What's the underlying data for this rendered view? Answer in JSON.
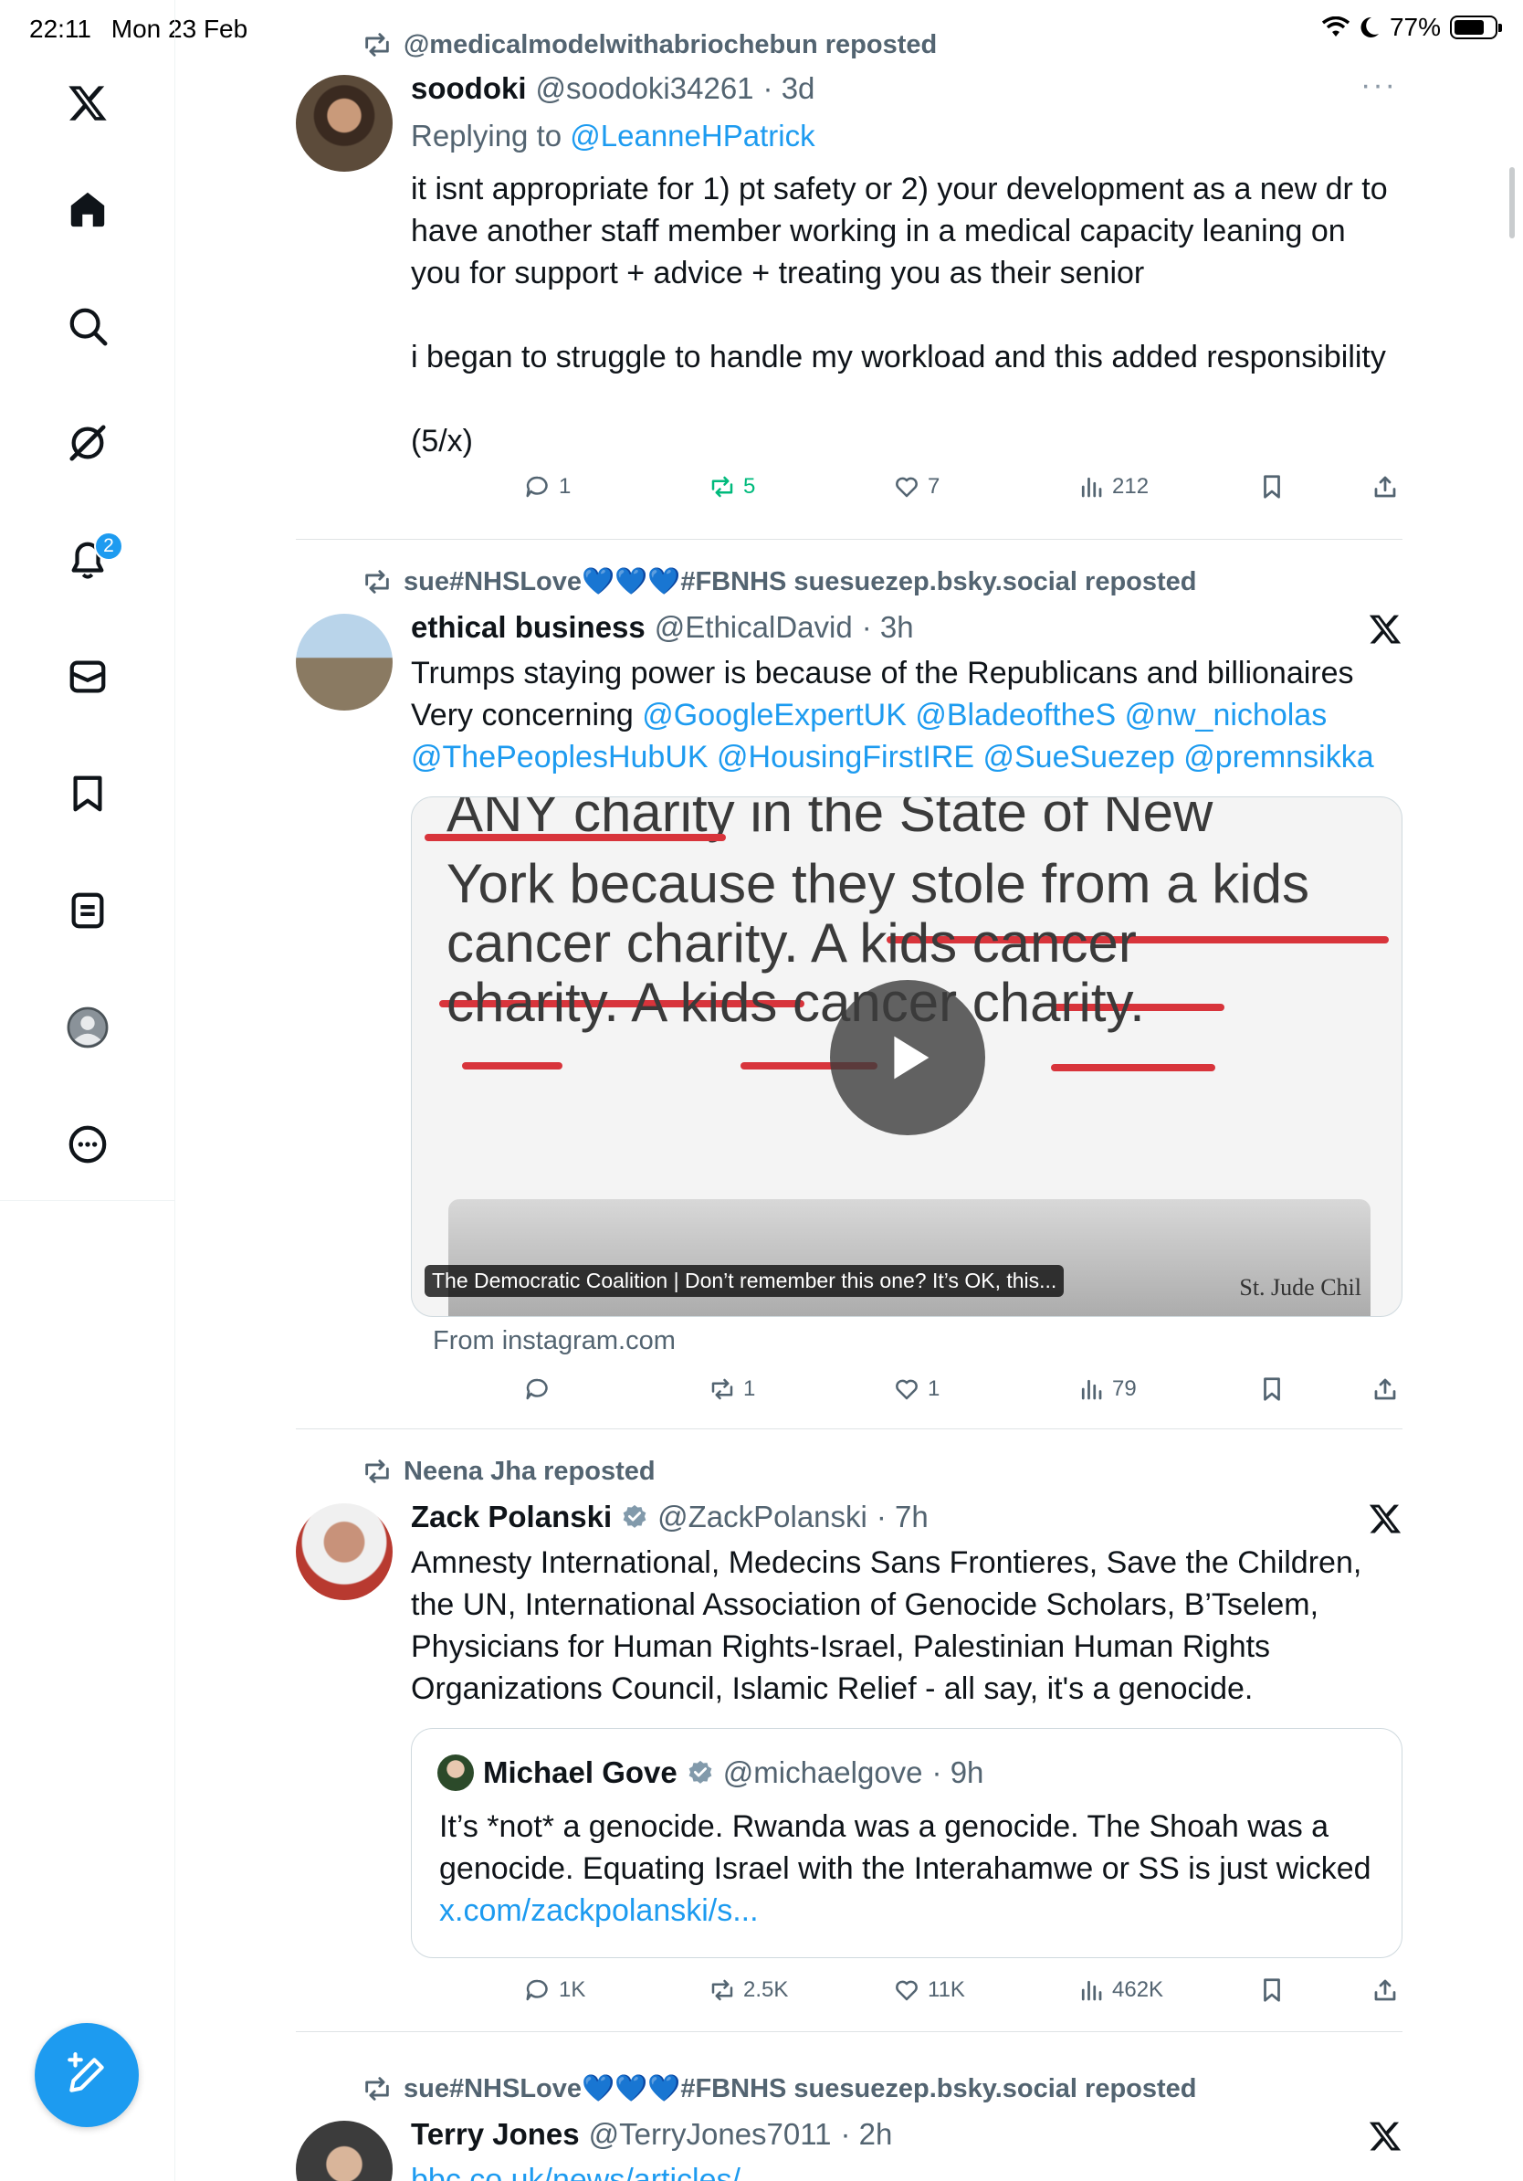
{
  "status": {
    "time": "22:11",
    "date": "Mon 23 Feb",
    "battery": "77%"
  },
  "sidebar": {
    "items": [
      "home-icon",
      "search-icon",
      "grok-icon",
      "notifications-icon",
      "messages-icon",
      "bookmarks-icon",
      "lists-icon",
      "profile-icon",
      "more-icon"
    ],
    "notifications_badge": "2"
  },
  "posts": [
    {
      "repost_by": "@medicalmodelwithabriochebun reposted",
      "name": "soodoki",
      "handle": "@soodoki34261",
      "time": "· 3d",
      "reply_prefix": "Replying to ",
      "reply_to": "@LeanneHPatrick",
      "text": "it isnt appropriate for 1) pt safety or 2) your development as a new dr to have another staff member working in a medical capacity leaning on you for support + advice + treating you as their senior\n\ni began to struggle to handle my workload and this added responsibility\n\n(5/x)",
      "replies": "1",
      "reposts": "5",
      "likes": "7",
      "views": "212"
    },
    {
      "repost_by": "sue#NHSLove💙💙💙#FBNHS suesuezep.bsky.social reposted",
      "name": "ethical business",
      "handle": "@EthicalDavid",
      "time": "· 3h",
      "text_plain": "Trumps staying power is because of the Republicans and billionaires Very concerning ",
      "mentions": "@GoogleExpertUK @BladeoftheS @nw_nicholas @ThePeoplesHubUK @HousingFirstIRE @SueSuezep @premnsikka",
      "media_lines": [
        "ANY charity in the State of New",
        "York because they stole from a kids",
        "cancer charity. A kids cancer",
        "charity. A kids cancer charity."
      ],
      "media_caption": "The Democratic Coalition | Don’t remember this one? It’s OK, this...",
      "media_corner": "St. Jude Chil",
      "from": "From instagram.com",
      "replies": "",
      "reposts": "1",
      "likes": "1",
      "views": "79"
    },
    {
      "repost_by": "Neena Jha reposted",
      "name": "Zack Polanski",
      "handle": "@ZackPolanski",
      "time": "· 7h",
      "text": "Amnesty International, Medecins Sans Frontieres, Save the Children, the UN, International Association of Genocide Scholars, B’Tselem, Physicians for Human Rights-Israel, Palestinian Human Rights Organizations Council, Islamic Relief - all say, it's a genocide.",
      "quote": {
        "name": "Michael Gove",
        "handle": "@michaelgove",
        "time": "· 9h",
        "text": "It’s *not* a genocide. Rwanda was a genocide. The Shoah was a genocide. Equating Israel with the Interahamwe or SS is just wicked ",
        "link": "x.com/zackpolanski/s..."
      },
      "replies": "1K",
      "reposts": "2.5K",
      "likes": "11K",
      "views": "462K"
    },
    {
      "repost_by": "sue#NHSLove💙💙💙#FBNHS suesuezep.bsky.social reposted",
      "name": "Terry Jones",
      "handle": "@TerryJones7011",
      "time": "· 2h",
      "link": "bbc.co.uk/news/articles/..."
    }
  ],
  "colors": {
    "accent": "#1d9bf0",
    "repost_green": "#00ba7c",
    "muted": "#536471"
  }
}
